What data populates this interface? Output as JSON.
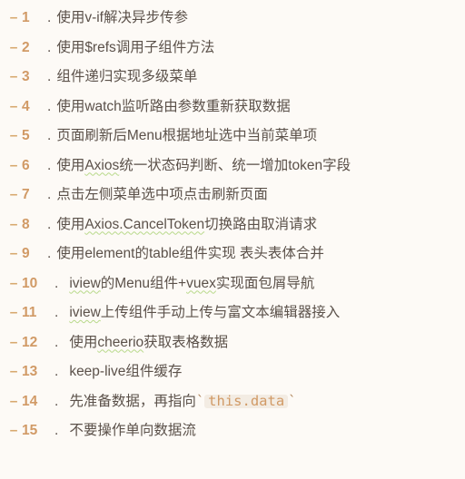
{
  "items": [
    {
      "n": "1",
      "text": "使用v-if解决异步传参",
      "wavy": []
    },
    {
      "n": "2",
      "text": "使用$refs调用子组件方法",
      "wavy": []
    },
    {
      "n": "3",
      "text": "组件递归实现多级菜单",
      "wavy": []
    },
    {
      "n": "4",
      "text": "使用watch监听路由参数重新获取数据",
      "wavy": []
    },
    {
      "n": "5",
      "text": "页面刷新后Menu根据地址选中当前菜单项",
      "wavy": []
    },
    {
      "n": "6",
      "text": "使用Axios统一状态码判断、统一增加token字段",
      "wavy": [
        "Axios"
      ]
    },
    {
      "n": "7",
      "text": "点击左侧菜单选中项点击刷新页面",
      "wavy": []
    },
    {
      "n": "8",
      "text": "使用Axios.CancelToken切换路由取消请求",
      "wavy": [
        "Axios.CancelToken"
      ]
    },
    {
      "n": "9",
      "text": "使用element的table组件实现 表头表体合并",
      "wavy": []
    },
    {
      "n": "10",
      "text": "iview的Menu组件+vuex实现面包屑导航",
      "wavy": [
        "iview",
        "vuex"
      ],
      "indent": true
    },
    {
      "n": "11",
      "text": "iview上传组件手动上传与富文本编辑器接入",
      "wavy": [
        "iview"
      ],
      "indent": true
    },
    {
      "n": "12",
      "text": "使用cheerio获取表格数据",
      "wavy": [
        "cheerio"
      ],
      "indent": true
    },
    {
      "n": "13",
      "text": "keep-live组件缓存",
      "wavy": [],
      "indent": true
    },
    {
      "n": "14",
      "text": "先准备数据，再指向",
      "code": "this.data",
      "wavy": [],
      "indent": true
    },
    {
      "n": "15",
      "text": "不要操作单向数据流",
      "wavy": [],
      "indent": true
    }
  ]
}
